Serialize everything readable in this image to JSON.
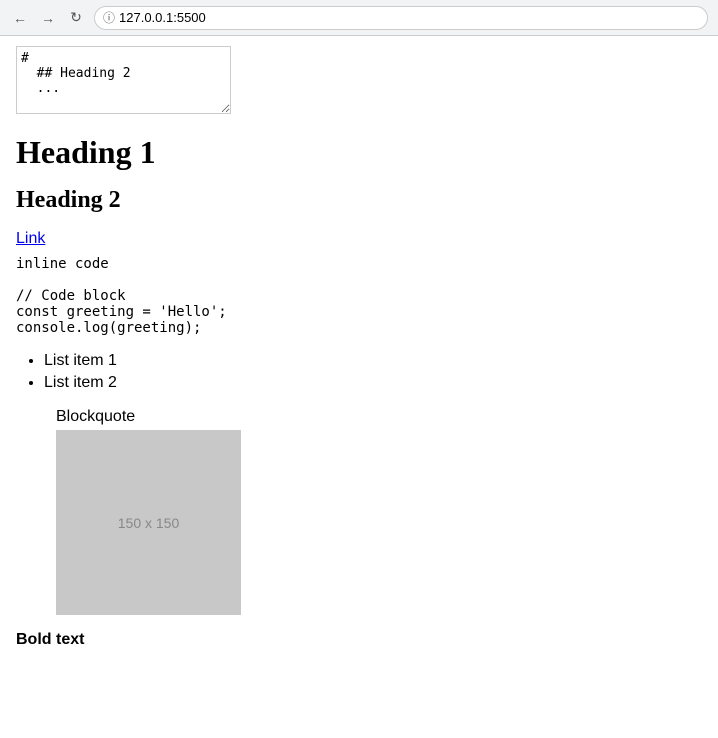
{
  "browser": {
    "url": "127.0.0.1:5500",
    "back_label": "←",
    "forward_label": "→",
    "reload_label": "↻",
    "security_icon": "ⓘ"
  },
  "editor": {
    "content": "#\n  ## Heading 2\n  ..."
  },
  "headings": {
    "h1": "Heading 1",
    "h2": "Heading 2"
  },
  "link": {
    "text": "Link",
    "href": "#"
  },
  "inline_code": "inline code",
  "code_block": "// Code block\nconst greeting = 'Hello';\nconsole.log(greeting);",
  "list": {
    "items": [
      "List item 1",
      "List item 2"
    ]
  },
  "blockquote": {
    "label": "Blockquote",
    "image_placeholder": "150 x 150"
  },
  "bold_text": "Bold text"
}
